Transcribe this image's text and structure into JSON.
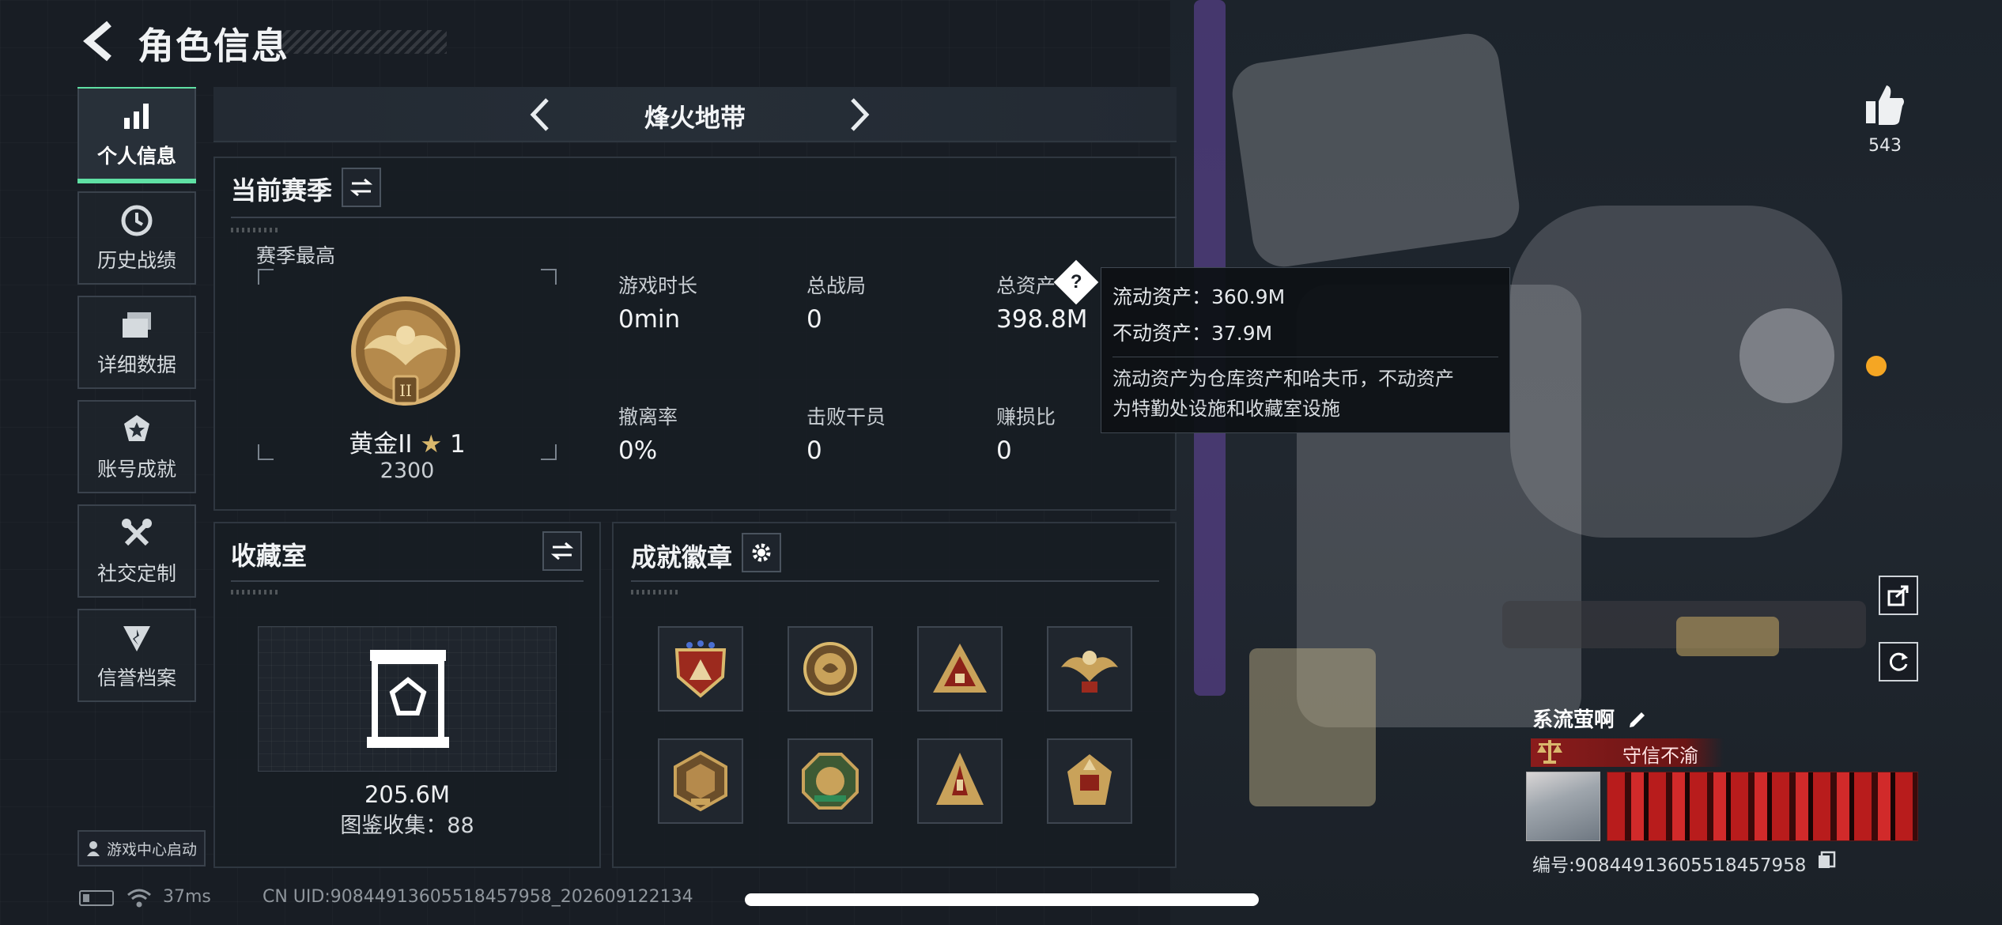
{
  "header": {
    "title": "角色信息"
  },
  "sidebar": {
    "items": [
      {
        "label": "个人信息",
        "icon": "stats-bars-icon"
      },
      {
        "label": "历史战绩",
        "icon": "clock-icon"
      },
      {
        "label": "详细数据",
        "icon": "folders-icon"
      },
      {
        "label": "账号成就",
        "icon": "achievement-star-icon"
      },
      {
        "label": "社交定制",
        "icon": "tools-icon"
      },
      {
        "label": "信誉档案",
        "icon": "credit-shield-icon"
      }
    ],
    "launch_label": "游戏中心启动"
  },
  "mode_bar": {
    "label": "烽火地带"
  },
  "season": {
    "title": "当前赛季",
    "best_label": "赛季最高",
    "rank_name": "黄金II",
    "rank_stars": "1",
    "rank_score": "2300",
    "stats": [
      {
        "label": "游戏时长",
        "value": "0min"
      },
      {
        "label": "总战局",
        "value": "0"
      },
      {
        "label": "总资产",
        "value": "398.8M"
      },
      {
        "label": "撤离率",
        "value": "0%"
      },
      {
        "label": "击败干员",
        "value": "0"
      },
      {
        "label": "赚损比",
        "value": "0"
      }
    ],
    "help_glyph": "?"
  },
  "tooltip": {
    "liquid": "流动资产：360.9M",
    "fixed": "不动资产：37.9M",
    "desc_line1": "流动资产为仓库资产和哈夫币，不动资产",
    "desc_line2": "为特勤处设施和收藏室设施"
  },
  "collection": {
    "title": "收藏室",
    "value": "205.6M",
    "count": "图鉴收集：88"
  },
  "achievements": {
    "title": "成就徽章",
    "badge_count": 8
  },
  "profile": {
    "likes": "543",
    "name": "系流萤啊",
    "honor": "守信不渝",
    "id_text": "编号:9084491360551845795​8"
  },
  "footer": {
    "ping": "37ms",
    "uid": "CN UID:9084491360551845795​8_202609122134"
  },
  "colors": {
    "accent": "#5fe0a4",
    "honor_red": "#8b1c1c",
    "gold": "#c9a25a"
  }
}
